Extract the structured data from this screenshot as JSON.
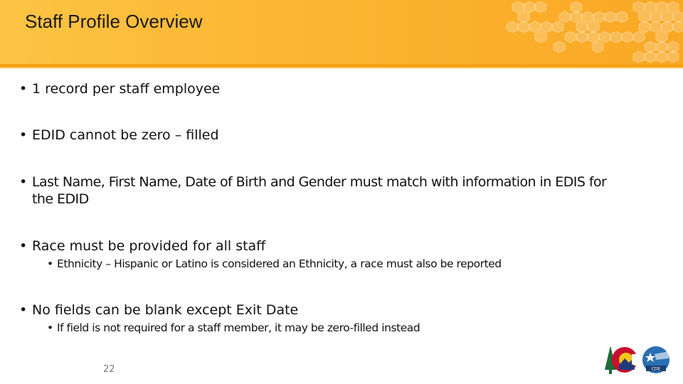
{
  "slide": {
    "title": "Staff Profile Overview",
    "colors": {
      "header_left": "#fdc443",
      "header_right": "#f9a825",
      "header_bar": "#f7a21b"
    },
    "bullets": [
      {
        "text": "1 record per staff employee",
        "sub": []
      },
      {
        "text": "EDID cannot be zero – filled",
        "sub": []
      },
      {
        "text": "Last Name, First Name, Date of Birth and Gender must match with information in EDIS for the EDID",
        "sub": []
      },
      {
        "text": "Race must be provided for all staff",
        "sub": [
          "Ethnicity – Hispanic or Latino is considered an Ethnicity, a race must also be reported"
        ]
      },
      {
        "text": "No fields can be blank except Exit Date",
        "sub": [
          "If field is not required for a staff member, it may be zero-filled instead"
        ]
      }
    ],
    "bullet_char": "•",
    "page_number": "22",
    "logos": {
      "state": "colorado-state-logo",
      "agency": "CDE",
      "agency_text": "CDE"
    }
  }
}
